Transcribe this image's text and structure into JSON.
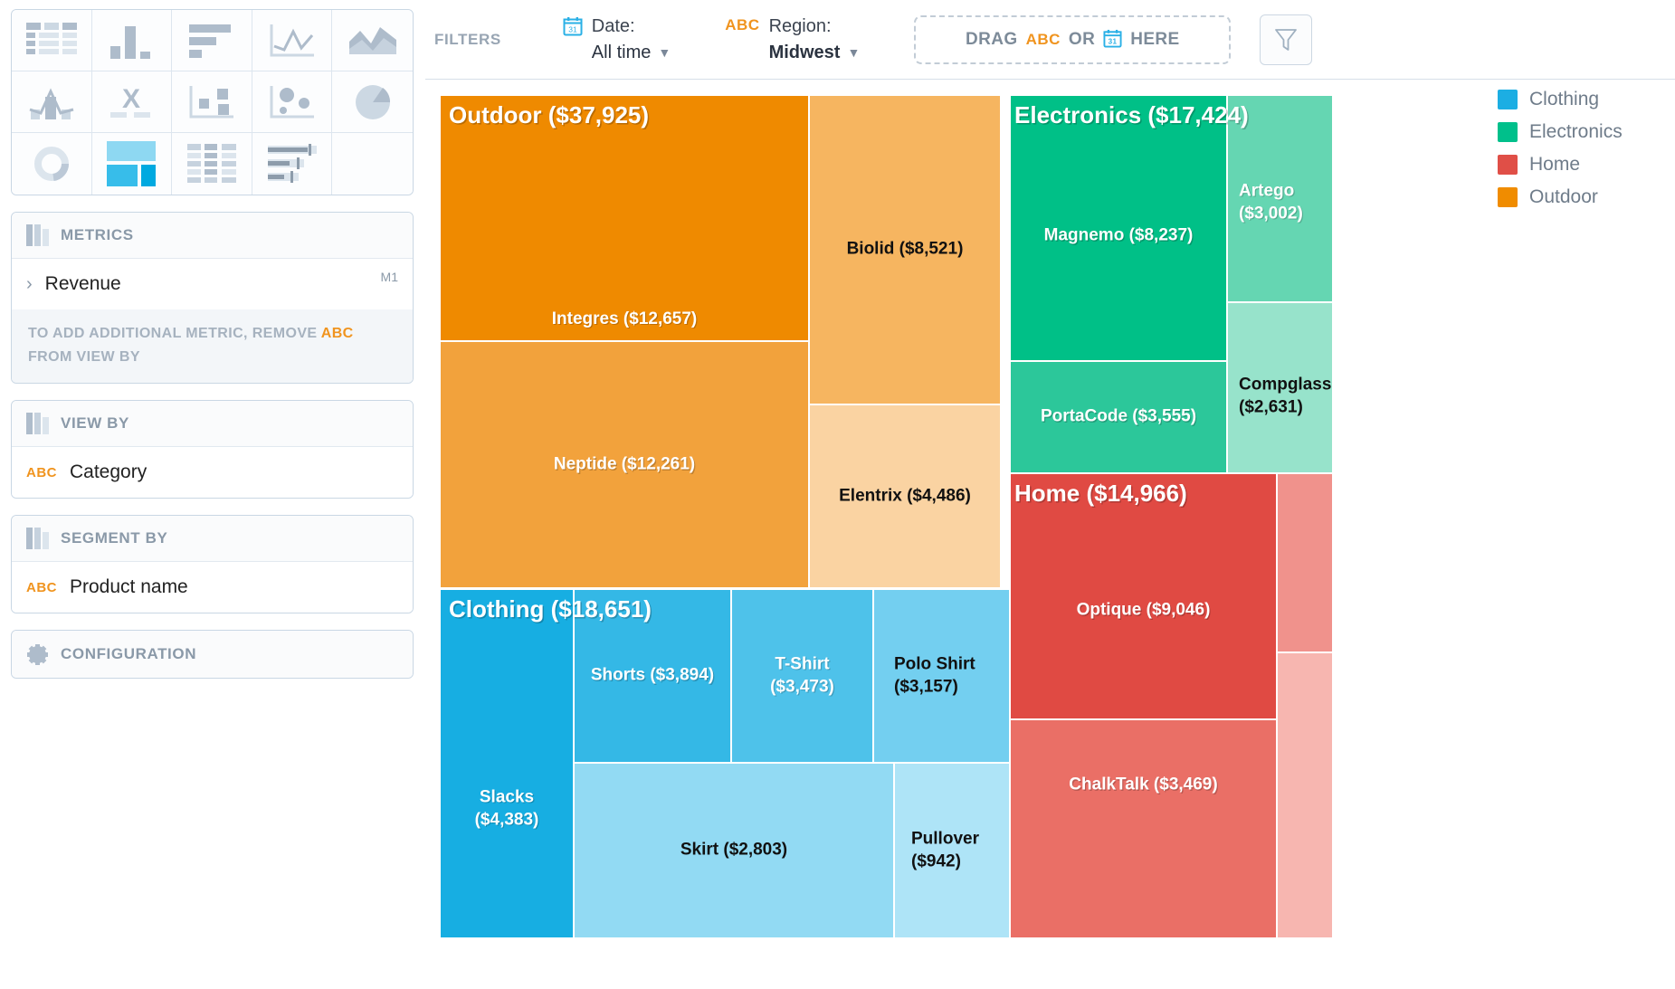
{
  "sidebar": {
    "chart_types": [
      {
        "name": "table-chart-icon",
        "label": "Table"
      },
      {
        "name": "column-chart-icon",
        "label": "Column chart"
      },
      {
        "name": "bar-chart-icon",
        "label": "Bar chart"
      },
      {
        "name": "line-chart-icon",
        "label": "Line chart"
      },
      {
        "name": "area-chart-icon",
        "label": "Area chart"
      },
      {
        "name": "combo-chart-icon",
        "label": "Combo chart"
      },
      {
        "name": "scatter-x-chart-icon",
        "label": "Scatter X"
      },
      {
        "name": "bubble-grid-chart-icon",
        "label": "Bubble grid"
      },
      {
        "name": "bubble-chart-icon",
        "label": "Bubble chart"
      },
      {
        "name": "pie-chart-icon",
        "label": "Pie chart"
      },
      {
        "name": "donut-chart-icon",
        "label": "Donut chart"
      },
      {
        "name": "treemap-chart-icon",
        "label": "Treemap"
      },
      {
        "name": "pivot-table-chart-icon",
        "label": "Pivot table"
      },
      {
        "name": "bullet-chart-icon",
        "label": "Bullet chart"
      },
      {
        "name": "empty-cell",
        "label": ""
      }
    ],
    "selected_chart_type": "treemap-chart-icon",
    "metrics": {
      "title": "METRICS",
      "items": [
        {
          "label": "Revenue",
          "tag": "M1"
        }
      ],
      "hint_prefix": "TO ADD ADDITIONAL METRIC, REMOVE",
      "hint_badge": "ABC",
      "hint_suffix": "FROM VIEW BY"
    },
    "view_by": {
      "title": "VIEW BY",
      "items": [
        {
          "badge": "ABC",
          "label": "Category"
        }
      ]
    },
    "segment_by": {
      "title": "SEGMENT BY",
      "items": [
        {
          "badge": "ABC",
          "label": "Product name"
        }
      ]
    },
    "configuration": {
      "title": "CONFIGURATION"
    }
  },
  "filterbar": {
    "label": "FILTERS",
    "filters": [
      {
        "icon": "calendar-icon",
        "name": "Date:",
        "value": "All time",
        "bold": false,
        "caret": "⌄"
      },
      {
        "icon": "abc-icon",
        "name": "Region:",
        "value": "Midwest",
        "bold": true,
        "caret": "⌄"
      }
    ],
    "dropzone": {
      "prefix": "DRAG",
      "badge_abc": "ABC",
      "middle": "OR",
      "badge_date": "calendar-icon",
      "suffix": "HERE"
    },
    "funnel_button": "funnel-icon"
  },
  "colors": {
    "clothing": "#1CAEE3",
    "electronics": "#00C08B",
    "home": "#E04F47",
    "outdoor": "#F08C00"
  },
  "chart_data": {
    "type": "treemap",
    "title": "Revenue by Category and Product name",
    "metric": "Revenue",
    "view_by": "Category",
    "segment_by": "Product name",
    "legend": [
      {
        "label": "Clothing",
        "color": "#1CAEE3"
      },
      {
        "label": "Electronics",
        "color": "#00C08B"
      },
      {
        "label": "Home",
        "color": "#E04F47"
      },
      {
        "label": "Outdoor",
        "color": "#F08C00"
      }
    ],
    "legend_position": "right",
    "groups": [
      {
        "category": "Outdoor",
        "value": 37925,
        "label": "Outdoor ($37,925)",
        "color": "#F08C00",
        "children": [
          {
            "name": "Integres",
            "value": 12657,
            "label": "Integres ($12,657)",
            "color": "#EF8A00"
          },
          {
            "name": "Neptide",
            "value": 12261,
            "label": "Neptide ($12,261)",
            "color": "#F2A23C"
          },
          {
            "name": "Biolid",
            "value": 8521,
            "label": "Biolid ($8,521)",
            "color": "#F6B560"
          },
          {
            "name": "Elentrix",
            "value": 4486,
            "label": "Elentrix ($4,486)",
            "color": "#FAD3A2"
          }
        ]
      },
      {
        "category": "Clothing",
        "value": 18651,
        "label": "Clothing ($18,651)",
        "color": "#1CAEE3",
        "children": [
          {
            "name": "Slacks",
            "value": 4383,
            "label": "Slacks ($4,383)",
            "color": "#17AEE2"
          },
          {
            "name": "Shorts",
            "value": 3894,
            "label": "Shorts ($3,894)",
            "color": "#34B8E6"
          },
          {
            "name": "T-Shirt",
            "value": 3473,
            "label": "T-Shirt ($3,473)",
            "color": "#4EC2EA"
          },
          {
            "name": "Polo Shirt",
            "value": 3157,
            "label": "Polo Shirt ($3,157)",
            "color": "#73CFF0"
          },
          {
            "name": "Skirt",
            "value": 2803,
            "label": "Skirt ($2,803)",
            "color": "#92DAF3"
          },
          {
            "name": "Pullover",
            "value": 942,
            "label": "Pullover ($942)",
            "color": "#AEE4F7"
          }
        ]
      },
      {
        "category": "Electronics",
        "value": 17424,
        "label": "Electronics ($17,424)",
        "color": "#00C08B",
        "children": [
          {
            "name": "Magnemo",
            "value": 8237,
            "label": "Magnemo ($8,237)",
            "color": "#00C087"
          },
          {
            "name": "PortaCode",
            "value": 3555,
            "label": "PortaCode ($3,555)",
            "color": "#2CC79A"
          },
          {
            "name": "Artego",
            "value": 3002,
            "label": "Artego ($3,002)",
            "color": "#65D6B2"
          },
          {
            "name": "Compglass",
            "value": 2631,
            "label": "Compglass ($2,631)",
            "color": "#97E3CB"
          }
        ]
      },
      {
        "category": "Home",
        "value": 14966,
        "label": "Home ($14,966)",
        "color": "#E04F47",
        "children": [
          {
            "name": "Optique",
            "value": 9046,
            "label": "Optique ($9,046)",
            "color": "#E04A43"
          },
          {
            "name": "ChalkTalk",
            "value": 3469,
            "label": "ChalkTalk ($3,469)",
            "color": "#EA6F66"
          },
          {
            "name": "",
            "value": 0,
            "label": "",
            "color": "#F0928C"
          },
          {
            "name": "",
            "value": 0,
            "label": "",
            "color": "#F7B6B0"
          }
        ]
      }
    ]
  }
}
